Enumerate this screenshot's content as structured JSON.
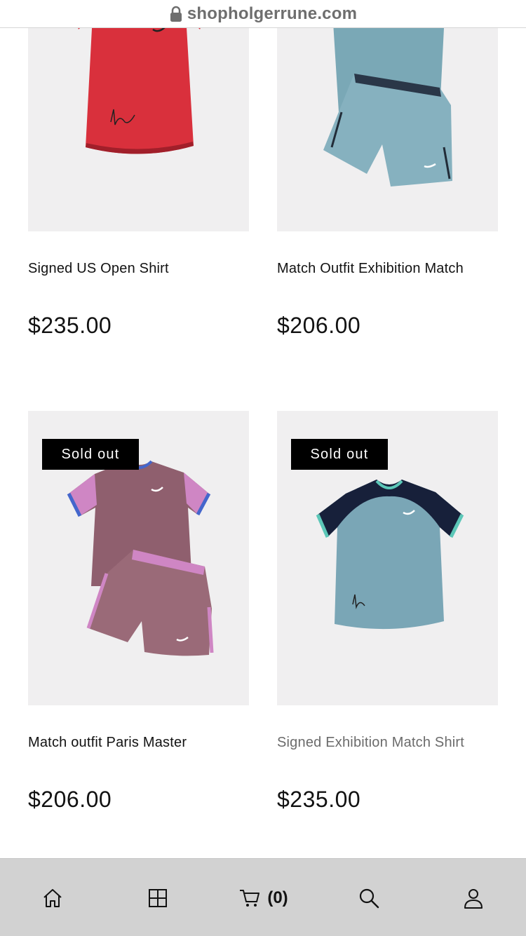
{
  "browser": {
    "host": "shopholgerrune.com",
    "lock_icon": "lock-icon"
  },
  "products": [
    {
      "title": "Signed US Open Shirt",
      "price": "$235.00",
      "sold_out": false,
      "image": "red-shirt"
    },
    {
      "title": "Match Outfit Exhibition Match",
      "price": "$206.00",
      "sold_out": false,
      "image": "blue-shirt-shorts"
    },
    {
      "title": "Match outfit Paris Master",
      "price": "$206.00",
      "sold_out": true,
      "badge": "Sold out",
      "image": "purple-outfit"
    },
    {
      "title": "Signed Exhibition Match Shirt",
      "price": "$235.00",
      "sold_out": true,
      "badge": "Sold out",
      "image": "blue-navy-shirt"
    }
  ],
  "bottom_nav": {
    "items": [
      "home-icon",
      "grid-icon",
      "cart-icon",
      "search-icon",
      "account-icon"
    ],
    "cart_count": "(0)"
  },
  "colors": {
    "badge": "#000000",
    "media_bg": "#f0eff0",
    "nav_bg": "#d2d2d2"
  }
}
